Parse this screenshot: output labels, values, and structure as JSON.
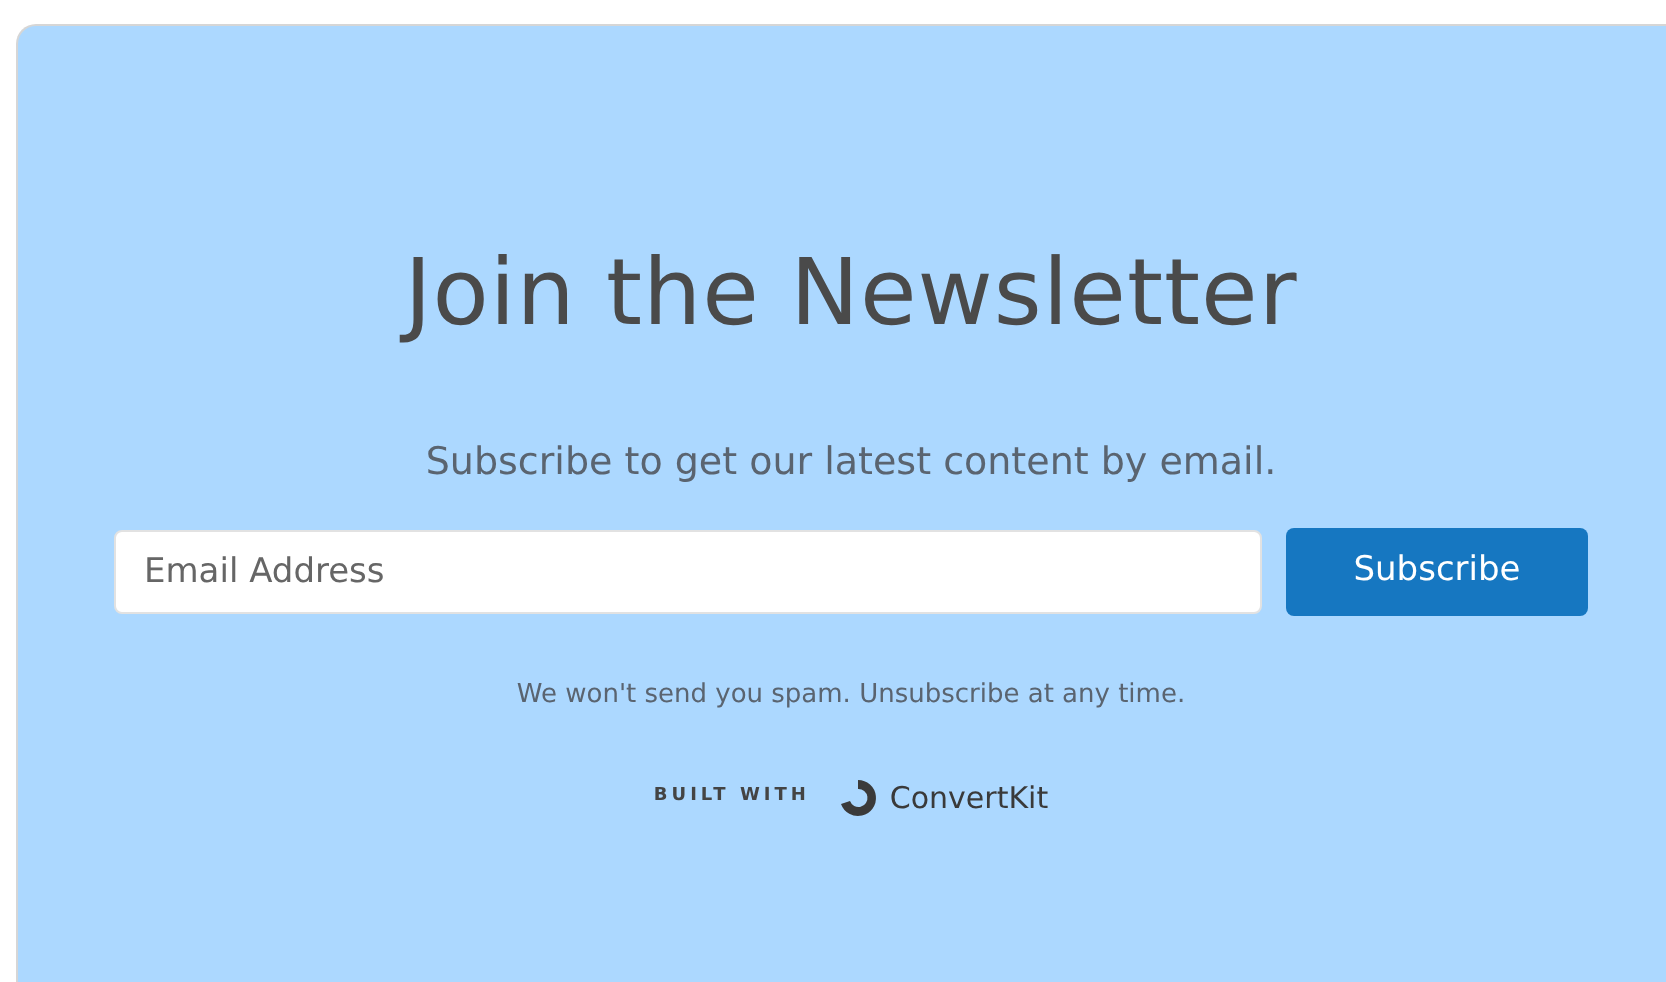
{
  "heading": "Join the Newsletter",
  "subheading": "Subscribe to get our latest content by email.",
  "email_field": {
    "placeholder": "Email Address"
  },
  "subscribe_button": "Subscribe",
  "disclaimer": "We won't send you spam. Unsubscribe at any time.",
  "footer": {
    "built_with": "BUILT WITH",
    "brand": "ConvertKit"
  }
}
